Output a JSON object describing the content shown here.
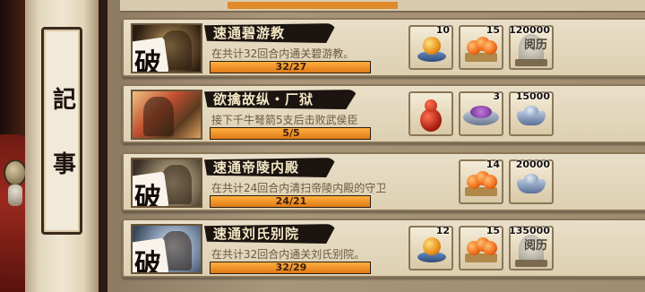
{
  "scroll": {
    "char1": "記",
    "char2": "事"
  },
  "quests": [
    {
      "badge": "破",
      "title": "速通碧游教",
      "desc": "在共计32回合内通关碧游教。",
      "progress_text": "32/27",
      "progress_value": 1.0,
      "rewards": [
        {
          "icon": "gold-orb-icon",
          "count": "10"
        },
        {
          "icon": "peach-tray-icon",
          "count": "15"
        },
        {
          "icon": "book-icon",
          "label": "阅历",
          "count": "120000"
        }
      ]
    },
    {
      "badge": "",
      "title": "欲擒故纵・厂狱",
      "desc": "接下千牛弩箭5支后击败武侯臣",
      "progress_text": "5/5",
      "progress_value": 1.0,
      "rewards": [
        {
          "icon": "gourd-icon",
          "count": ""
        },
        {
          "icon": "gem-plate-icon",
          "count": "3"
        },
        {
          "icon": "silver-ingot-icon",
          "count": "15000"
        }
      ]
    },
    {
      "badge": "破",
      "title": "速通帝陵内殿",
      "desc": "在共计24回合内清扫帝陵内殿的守卫",
      "progress_text": "24/21",
      "progress_value": 1.0,
      "rewards": [
        {
          "icon": "peach-tray-icon",
          "count": "14"
        },
        {
          "icon": "silver-ingot-icon",
          "count": "20000"
        }
      ]
    },
    {
      "badge": "破",
      "title": "速通刘氏别院",
      "desc": "在共计32回合内通关刘氏别院。",
      "progress_text": "32/29",
      "progress_value": 1.0,
      "rewards": [
        {
          "icon": "gold-orb-icon",
          "count": "12"
        },
        {
          "icon": "peach-tray-icon",
          "count": "15"
        },
        {
          "icon": "book-icon",
          "label": "阅历",
          "count": "135000"
        }
      ]
    }
  ]
}
